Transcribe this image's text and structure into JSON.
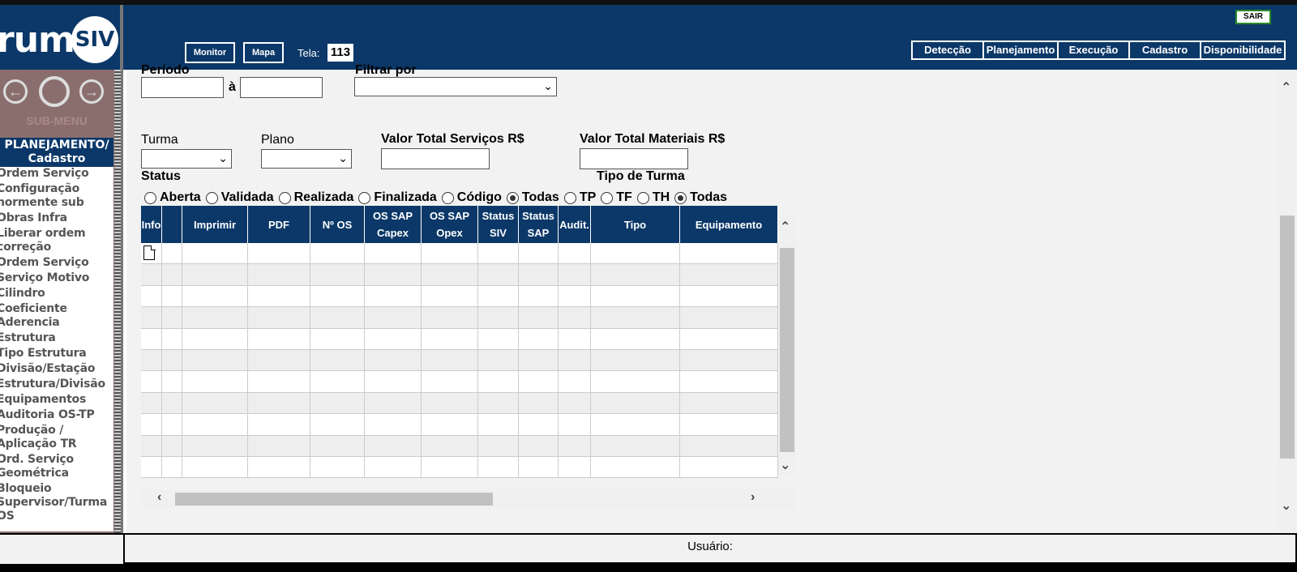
{
  "logo": {
    "text": "rumo",
    "badge": "SIV"
  },
  "sidebar": {
    "submenu_label": "SUB-MENU",
    "header": "PLANEJAMENTO/ Cadastro",
    "items": [
      "Ordem Serviço",
      "Configuração",
      "normente sub",
      "Obras Infra",
      "Liberar ordem",
      "correção",
      "Ordem Serviço",
      "Serviço Motivo",
      "Cilindro",
      "Coeficiente",
      "Aderencia",
      "Estrutura",
      "Tipo Estrutura",
      "Divisão/Estação",
      "Estrutura/Divisão",
      "Equipamentos",
      "Auditoria OS-TP",
      "Produção /",
      "Aplicação TR",
      "Ord. Serviço",
      "Geométrica",
      "Bloqueio",
      "Supervisor/Turma",
      "OS"
    ]
  },
  "header": {
    "sair": "SAIR",
    "monitor": "Monitor",
    "mapa": "Mapa",
    "tela_label": "Tela:",
    "tela_value": "113",
    "menu": [
      "Detecção",
      "Planejamento",
      "Execução",
      "Cadastro",
      "Disponibilidade"
    ]
  },
  "form": {
    "periodo_label": "Período",
    "a_label": "à",
    "filtrar_label": "Filtrar por",
    "turma_label": "Turma",
    "plano_label": "Plano",
    "servicos_label": "Valor Total Serviços R$",
    "materiais_label": "Valor Total Materiais R$",
    "status_label": "Status",
    "tipo_turma_label": "Tipo de Turma",
    "status_options": [
      "Aberta",
      "Validada",
      "Realizada",
      "Finalizada",
      "Código",
      "Todas"
    ],
    "status_selected": "Todas",
    "tipo_options": [
      "TP",
      "TF",
      "TH",
      "Todas"
    ],
    "tipo_selected": "Todas"
  },
  "grid": {
    "columns": [
      {
        "line1": "Info",
        "line2": ""
      },
      {
        "line1": "",
        "line2": ""
      },
      {
        "line1": "Imprimir",
        "line2": ""
      },
      {
        "line1": "PDF",
        "line2": ""
      },
      {
        "line1": "Nº OS",
        "line2": ""
      },
      {
        "line1": "OS SAP",
        "line2": "Capex"
      },
      {
        "line1": "OS SAP",
        "line2": "Opex"
      },
      {
        "line1": "Status",
        "line2": "SIV"
      },
      {
        "line1": "Status",
        "line2": "SAP"
      },
      {
        "line1": "Audit.",
        "line2": ""
      },
      {
        "line1": "Tipo",
        "line2": ""
      },
      {
        "line1": "Equipamento",
        "line2": ""
      }
    ],
    "row_count": 11
  },
  "footer": {
    "usuario_label": "Usuário:"
  }
}
